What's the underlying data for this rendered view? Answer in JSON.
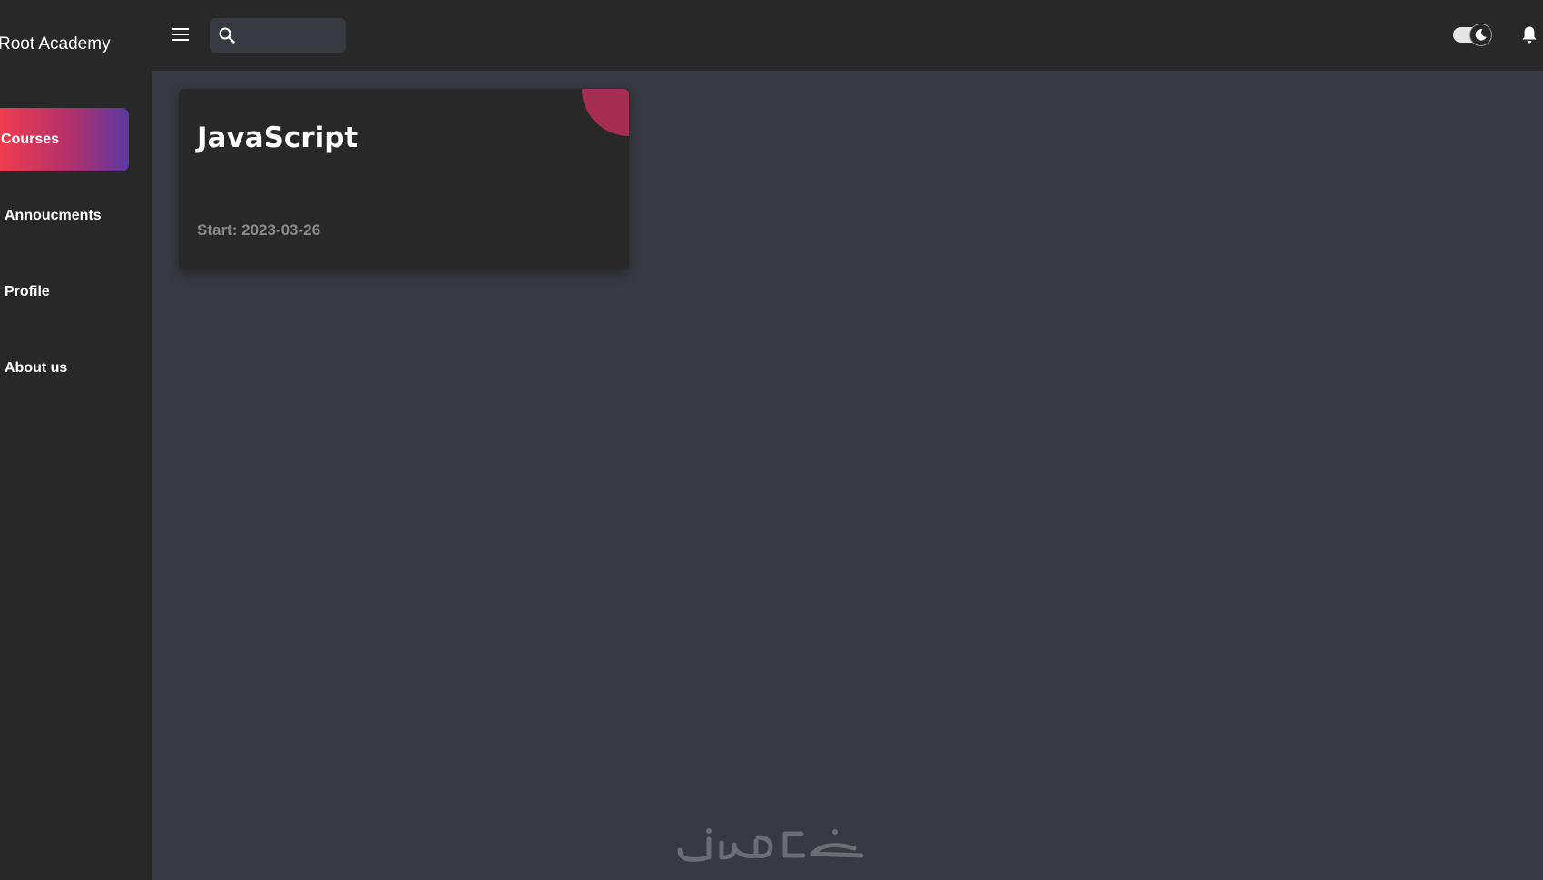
{
  "sidebar": {
    "brand": "Root Academy",
    "items": [
      {
        "label": "Courses",
        "active": true
      },
      {
        "label": "Annoucments",
        "active": false
      },
      {
        "label": "Profile",
        "active": false
      },
      {
        "label": "About us",
        "active": false
      }
    ],
    "active_gradient": [
      "#ef3d4f",
      "#5a3aa3"
    ]
  },
  "header": {
    "search": {
      "value": "",
      "placeholder": ""
    },
    "icons": [
      "menu-icon",
      "search-icon",
      "moon-icon",
      "bell-icon"
    ],
    "theme": "dark"
  },
  "main": {
    "courses": [
      {
        "title": "JavaScript",
        "start": "Start: 2023-03-26"
      }
    ]
  },
  "colors": {
    "sidebar_bg": "#282828",
    "main_bg": "#373a40",
    "card_bg": "#282828",
    "card_accent": "#a52c52"
  }
}
